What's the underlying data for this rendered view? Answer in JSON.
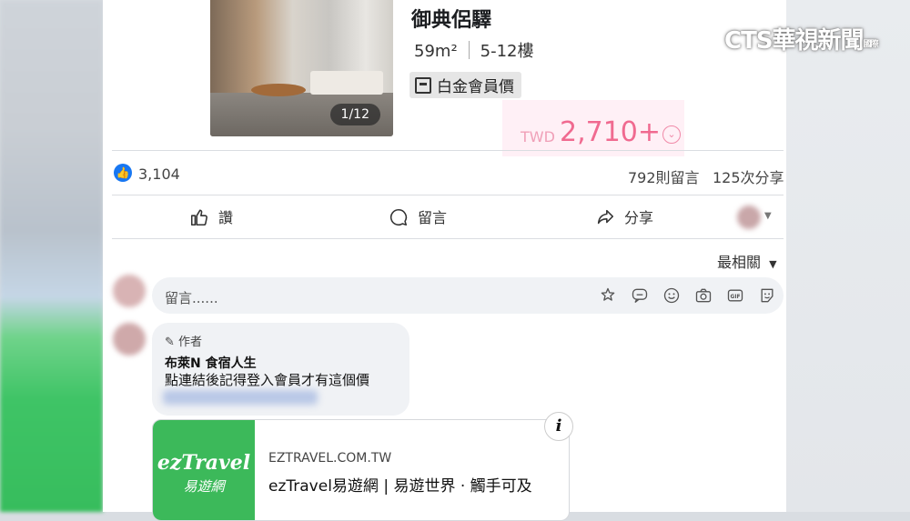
{
  "hotel": {
    "name": "御典侶驛",
    "size": "59m²",
    "floors": "5-12樓",
    "badge": "白金會員價",
    "photo_counter": "1/12",
    "price_currency": "TWD",
    "price_value": "2,710+"
  },
  "stats": {
    "likes": "3,104",
    "comments": "792則留言",
    "shares": "125次分享"
  },
  "actions": {
    "like": "讚",
    "comment": "留言",
    "share": "分享"
  },
  "sort": {
    "label": "最相關"
  },
  "comment_input": {
    "placeholder": "留言......"
  },
  "reply": {
    "author_tag": "作者",
    "name": "布萊N 食宿人生",
    "text": "點連結後記得登入會員才有這個價"
  },
  "link_card": {
    "logo": "ezTravel",
    "logo_sub": "易遊網",
    "domain": "EZTRAVEL.COM.TW",
    "title": "ezTravel易遊網 | 易遊世界 · 觸手可及"
  },
  "watermark": {
    "main": "CTS華視新聞",
    "side": "國際"
  },
  "colors": {
    "facebook_blue": "#1877f2",
    "price_pink": "#f06a90",
    "eztravel_green": "#3cb95a"
  }
}
